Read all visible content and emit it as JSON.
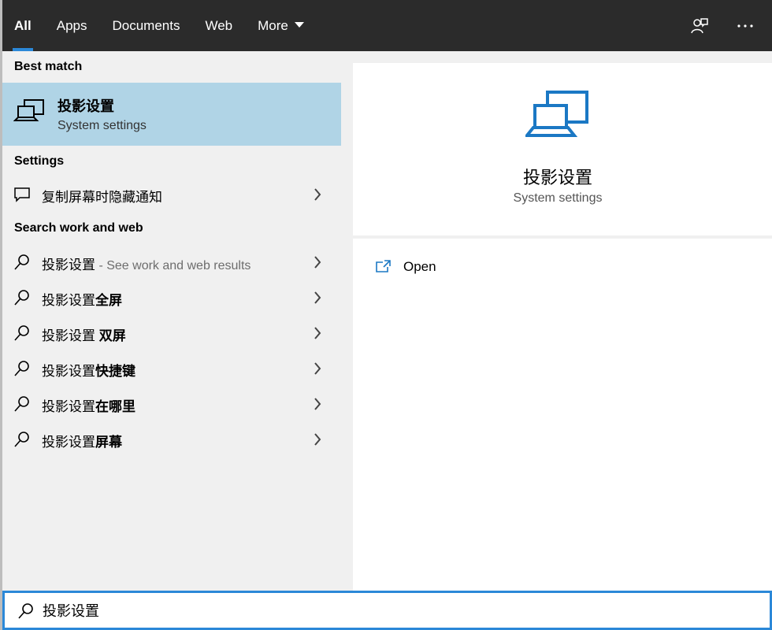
{
  "tabs": [
    {
      "label": "All"
    },
    {
      "label": "Apps"
    },
    {
      "label": "Documents"
    },
    {
      "label": "Web"
    },
    {
      "label": "More"
    }
  ],
  "top_icons": [
    "feedback-icon",
    "more-options-icon"
  ],
  "sections": {
    "best_match": "Best match",
    "settings": "Settings",
    "search_web": "Search work and web"
  },
  "best_match": {
    "title": "投影设置",
    "subtitle": "System settings",
    "icon": "projector-icon"
  },
  "settings_items": [
    {
      "label": "复制屏幕时隐藏通知",
      "icon": "notification-icon"
    }
  ],
  "web_items": [
    {
      "prefix": "投影设置",
      "bold": "",
      "hint": " - See work and web results"
    },
    {
      "prefix": "投影设置",
      "bold": "全屏",
      "hint": ""
    },
    {
      "prefix": "投影设置 ",
      "bold": "双屏",
      "hint": ""
    },
    {
      "prefix": "投影设置",
      "bold": "快捷键",
      "hint": ""
    },
    {
      "prefix": "投影设置",
      "bold": "在哪里",
      "hint": ""
    },
    {
      "prefix": "投影设置",
      "bold": "屏幕",
      "hint": ""
    }
  ],
  "preview": {
    "title": "投影设置",
    "subtitle": "System settings",
    "actions": [
      {
        "label": "Open",
        "icon": "open-icon"
      }
    ]
  },
  "search": {
    "value": "投影设置",
    "icon": "search-icon"
  },
  "colors": {
    "accent": "#2b88d8",
    "topbar": "#2b2b2b",
    "selected": "#b0d4e6"
  }
}
